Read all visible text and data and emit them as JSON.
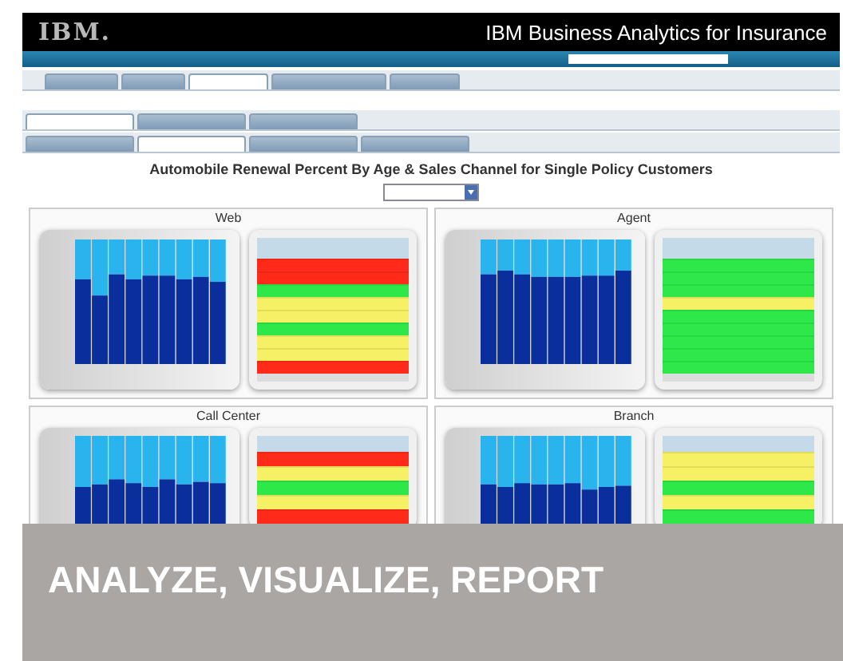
{
  "header": {
    "logo": "IBM.",
    "product": "IBM Business Analytics for Insurance"
  },
  "nav_tabs": [
    {
      "selected": false
    },
    {
      "selected": false
    },
    {
      "selected": true
    },
    {
      "selected": false
    },
    {
      "selected": false
    }
  ],
  "sub_tabs": [
    {
      "selected": true
    },
    {
      "selected": false
    },
    {
      "selected": false
    }
  ],
  "report_tabs": [
    {
      "selected": false
    },
    {
      "selected": true
    },
    {
      "selected": false
    },
    {
      "selected": false
    }
  ],
  "report": {
    "title": "Automobile Renewal Percent By Age & Sales Channel for Single Policy Customers"
  },
  "panels": [
    {
      "title": "Web",
      "rows": [
        {
          "color": "#ff2a1a"
        },
        {
          "color": "#ff2a1a"
        },
        {
          "color": "#2ee84a"
        },
        {
          "color": "#f5f064"
        },
        {
          "color": "#f5f064"
        },
        {
          "color": "#2ee84a"
        },
        {
          "color": "#f5f064"
        },
        {
          "color": "#f5f064"
        },
        {
          "color": "#ff2a1a"
        }
      ]
    },
    {
      "title": "Agent",
      "rows": [
        {
          "color": "#2ee84a"
        },
        {
          "color": "#2ee84a"
        },
        {
          "color": "#2ee84a"
        },
        {
          "color": "#f5f064"
        },
        {
          "color": "#2ee84a"
        },
        {
          "color": "#2ee84a"
        },
        {
          "color": "#2ee84a"
        },
        {
          "color": "#2ee84a"
        },
        {
          "color": "#2ee84a"
        }
      ]
    },
    {
      "title": "Call Center",
      "rows": [
        {
          "color": "#ff2a1a"
        },
        {
          "color": "#f5f064"
        },
        {
          "color": "#2ee84a"
        },
        {
          "color": "#f5f064"
        },
        {
          "color": "#ff2a1a"
        }
      ]
    },
    {
      "title": "Branch",
      "rows": [
        {
          "color": "#f5f064"
        },
        {
          "color": "#f5f064"
        },
        {
          "color": "#2ee84a"
        },
        {
          "color": "#f5f064"
        },
        {
          "color": "#2ee84a"
        }
      ]
    }
  ],
  "banner": {
    "text": "ANALYZE, VISUALIZE, REPORT"
  }
}
